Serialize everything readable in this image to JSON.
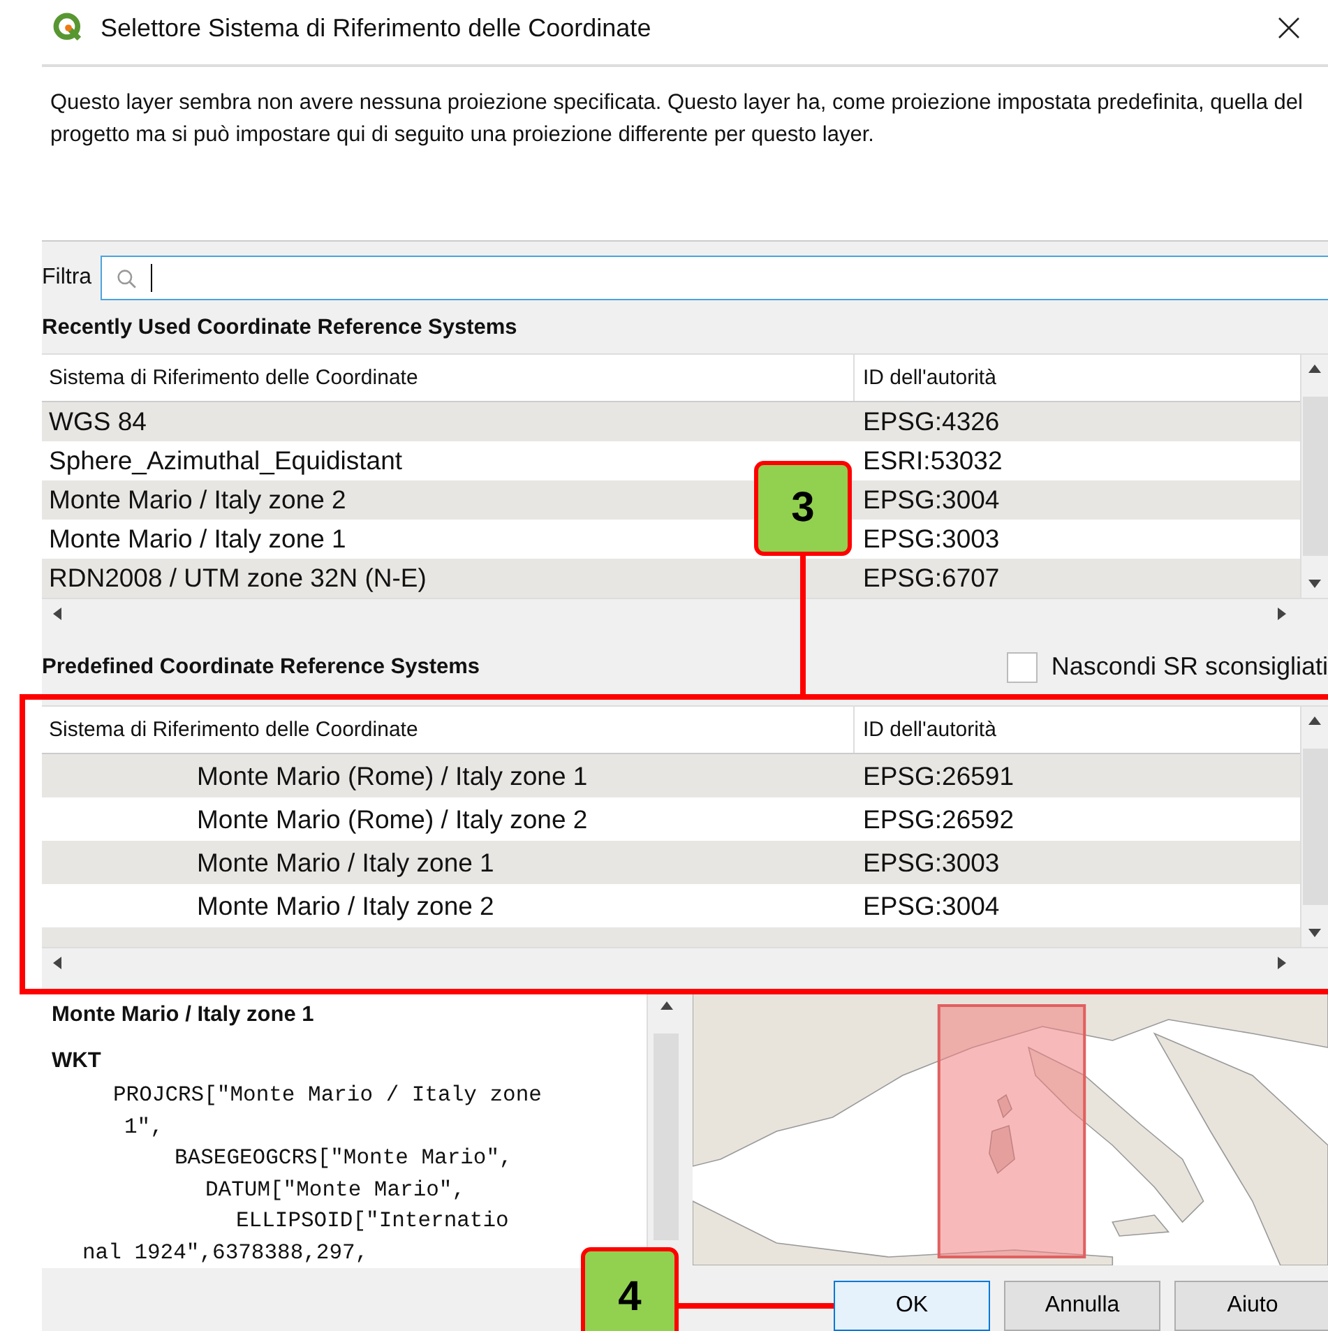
{
  "window": {
    "title": "Selettore Sistema di Riferimento delle Coordinate"
  },
  "description": "Questo layer sembra non avere nessuna proiezione specificata. Questo layer ha, come proiezione impostata predefinita, quella del progetto ma si può impostare qui di seguito una proiezione differente per questo layer.",
  "filter": {
    "label": "Filtra"
  },
  "recent": {
    "heading": "Recently Used Coordinate Reference Systems",
    "columns": [
      "Sistema di Riferimento delle Coordinate",
      "ID dell'autorità"
    ],
    "rows": [
      {
        "name": "WGS 84",
        "id": "EPSG:4326"
      },
      {
        "name": "Sphere_Azimuthal_Equidistant",
        "id": "ESRI:53032"
      },
      {
        "name": "Monte Mario / Italy zone 2",
        "id": "EPSG:3004"
      },
      {
        "name": "Monte Mario / Italy zone 1",
        "id": "EPSG:3003"
      },
      {
        "name": "RDN2008 / UTM zone 32N (N-E)",
        "id": "EPSG:6707"
      }
    ]
  },
  "predefined": {
    "heading": "Predefined Coordinate Reference Systems",
    "hide_deprecated": {
      "label": "Nascondi SR sconsigliati",
      "checked": false
    },
    "columns": [
      "Sistema di Riferimento delle Coordinate",
      "ID dell'autorità"
    ],
    "rows": [
      {
        "name": "Monte Mario (Rome) / Italy zone 1",
        "id": "EPSG:26591"
      },
      {
        "name": "Monte Mario (Rome) / Italy zone 2",
        "id": "EPSG:26592"
      },
      {
        "name": "Monte Mario / Italy zone 1",
        "id": "EPSG:3003"
      },
      {
        "name": "Monte Mario / Italy zone 2",
        "id": "EPSG:3004"
      }
    ]
  },
  "details": {
    "title": "Monte Mario / Italy zone 1",
    "section": "WKT",
    "wkt_lines": [
      "PROJCRS[\"Monte Mario / Italy zone",
      "1\",",
      "BASEGEOGCRS[\"Monte Mario\",",
      "DATUM[\"Monte Mario\",",
      "ELLIPSOID[\"Internatio",
      "nal 1924\",6378388,297,"
    ]
  },
  "map": {
    "kind": "picture"
  },
  "buttons": [
    "OK",
    "Annulla",
    "Aiuto"
  ],
  "annotations": [
    {
      "label": "3"
    },
    {
      "label": "4"
    }
  ]
}
